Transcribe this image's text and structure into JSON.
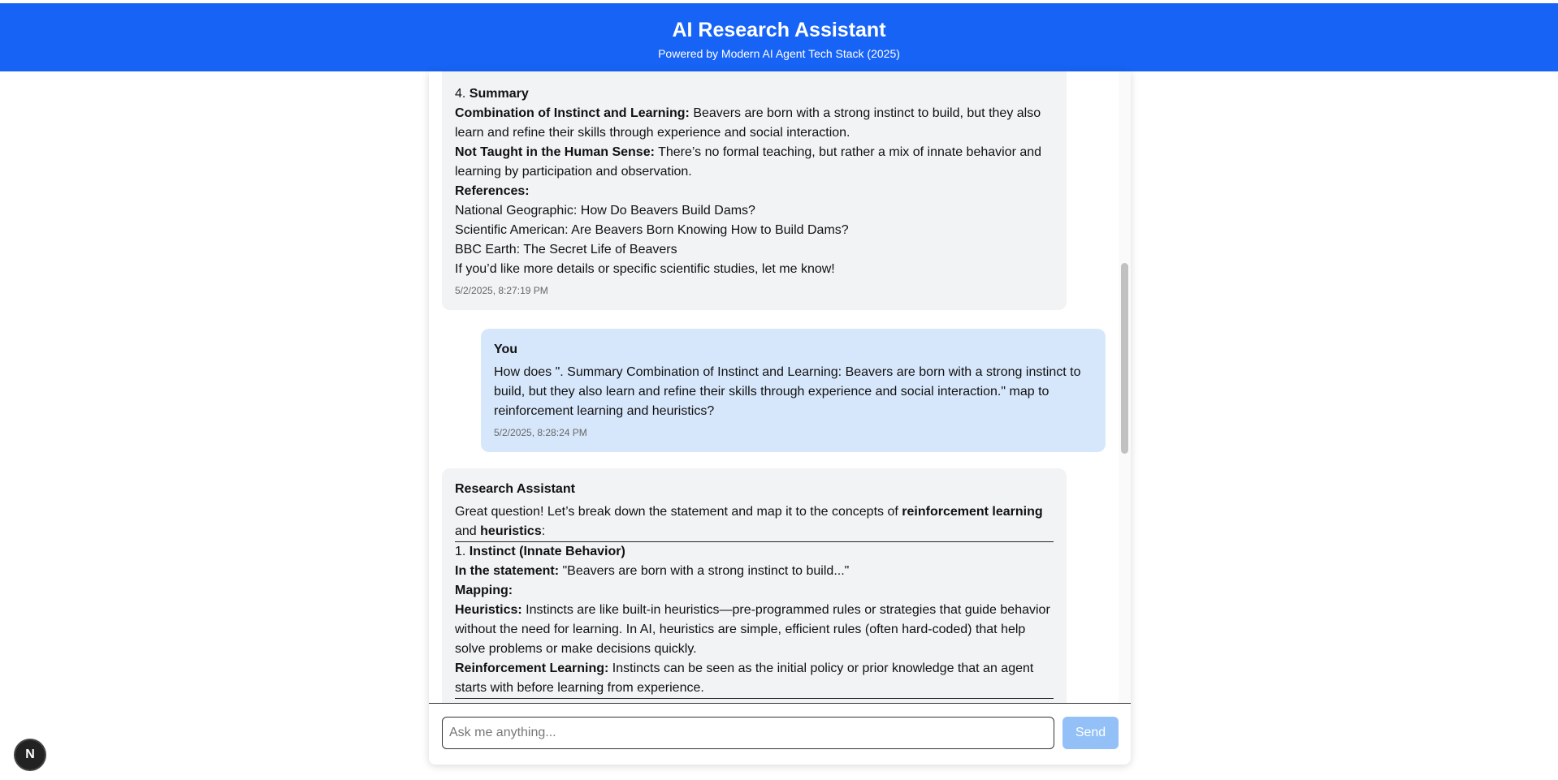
{
  "header": {
    "title": "AI Research Assistant",
    "subtitle": "Powered by Modern AI Agent Tech Stack (2025)"
  },
  "message1": {
    "cut_line": "4.",
    "summary_label": "Summary",
    "p1_label": "Combination of Instinct and Learning:",
    "p1_text": " Beavers are born with a strong instinct to build, but they also learn and refine their skills through experience and social interaction.",
    "p2_label": "Not Taught in the Human Sense:",
    "p2_text": " There’s no formal teaching, but rather a mix of innate behavior and learning by participation and observation.",
    "refs_label": "References:",
    "refs": [
      "National Geographic: How Do Beavers Build Dams?",
      "Scientific American: Are Beavers Born Knowing How to Build Dams?",
      "BBC Earth: The Secret Life of Beavers"
    ],
    "closing": "If you’d like more details or specific scientific studies, let me know!",
    "timestamp": "5/2/2025, 8:27:19 PM"
  },
  "message2": {
    "sender": "You",
    "text": "How does \". Summary Combination of Instinct and Learning: Beavers are born with a strong instinct to build, but they also learn and refine their skills through experience and social interaction.\" map to reinforcement learning and heuristics?",
    "timestamp": "5/2/2025, 8:28:24 PM"
  },
  "message3": {
    "sender": "Research Assistant",
    "intro_a": "Great question! Let’s break down the statement and map it to the concepts of ",
    "intro_b1": "reinforcement learning",
    "intro_c": " and ",
    "intro_b2": "heuristics",
    "intro_d": ":",
    "s1_num": "1. ",
    "s1_title": "Instinct (Innate Behavior)",
    "in_label": "In the statement:",
    "in_text": " \"Beavers are born with a strong instinct to build...\"",
    "mapping_label": "Mapping:",
    "h_label": "Heuristics:",
    "h_text": " Instincts are like built-in heuristics—pre-programmed rules or strategies that guide behavior without the need for learning. In AI, heuristics are simple, efficient rules (often hard-coded) that help solve problems or make decisions quickly.",
    "rl_label": "Reinforcement Learning:",
    "rl_text": " Instincts can be seen as the initial policy or prior knowledge that an agent starts with before learning from experience."
  },
  "input": {
    "placeholder": "Ask me anything...",
    "send_label": "Send"
  },
  "badge": {
    "label": "N"
  }
}
